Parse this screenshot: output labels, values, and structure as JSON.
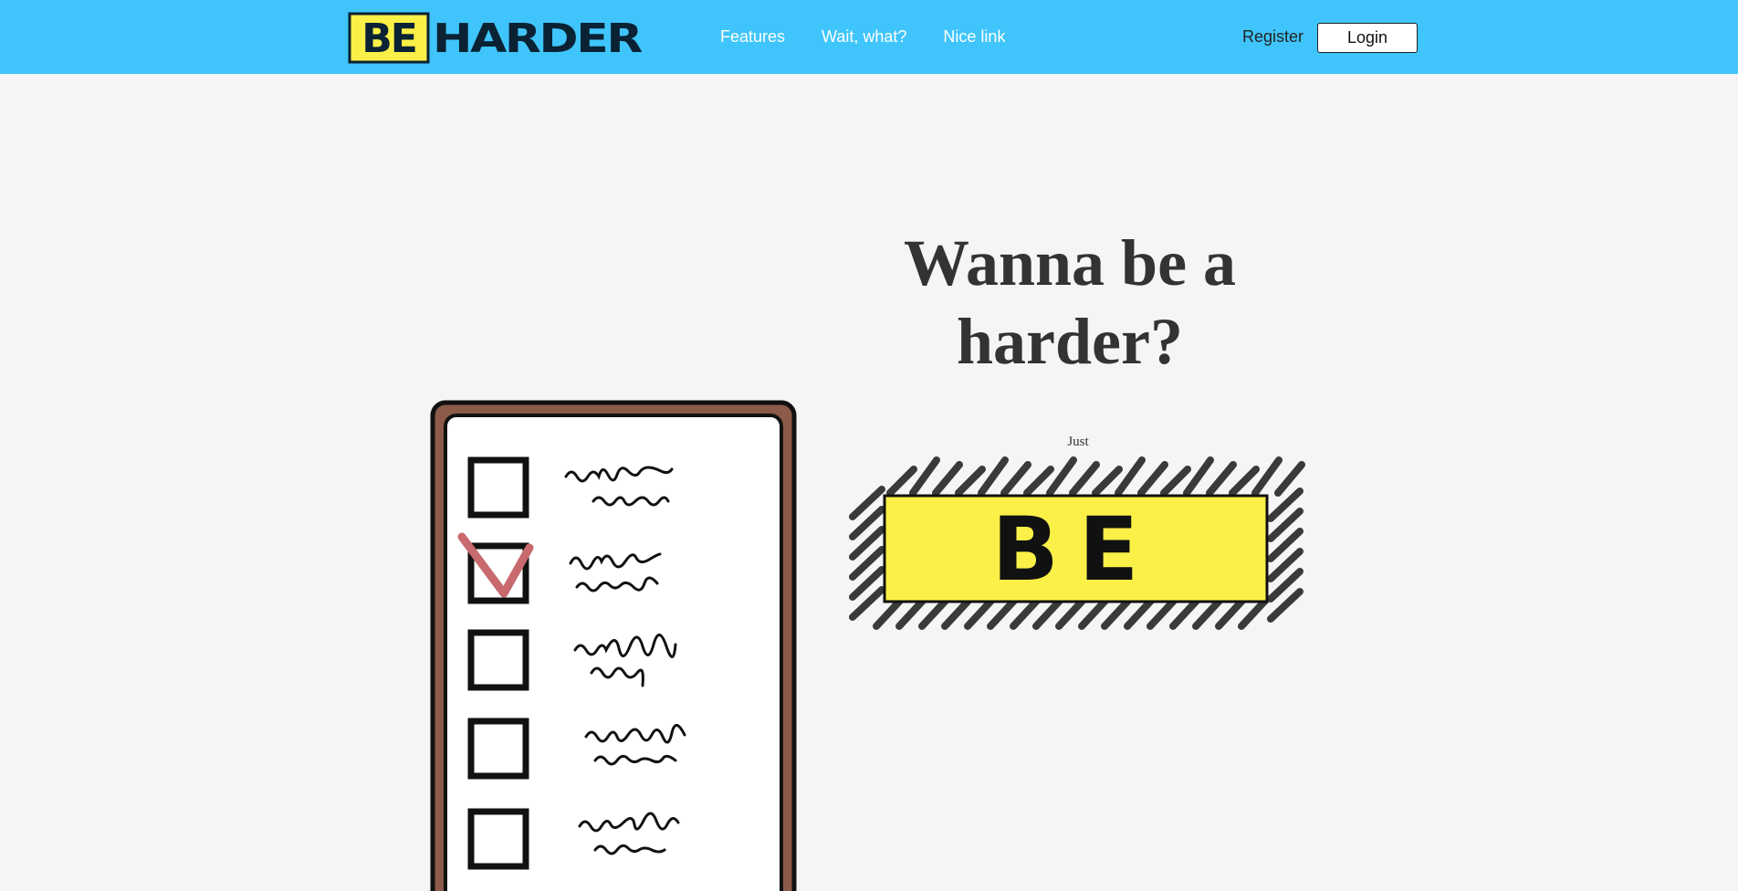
{
  "header": {
    "logo_be": "BE",
    "logo_harder": "HARDER",
    "nav": [
      {
        "label": "Features"
      },
      {
        "label": "Wait, what?"
      },
      {
        "label": "Nice link"
      }
    ],
    "register_label": "Register",
    "login_label": "Login"
  },
  "hero": {
    "title_line1": "Wanna be a",
    "title_line2": "harder?",
    "just": "Just",
    "badge_text": "BE"
  },
  "colors": {
    "navbar": "#3fc5fb",
    "logo_yellow": "#fbf047",
    "background": "#f5f5f5",
    "clipboard_brown": "#8b5a48",
    "check_red": "#c86a6e"
  },
  "clipboard": {
    "checkboxes": [
      {
        "checked": false
      },
      {
        "checked": true
      },
      {
        "checked": false
      },
      {
        "checked": false
      },
      {
        "checked": false
      }
    ]
  }
}
